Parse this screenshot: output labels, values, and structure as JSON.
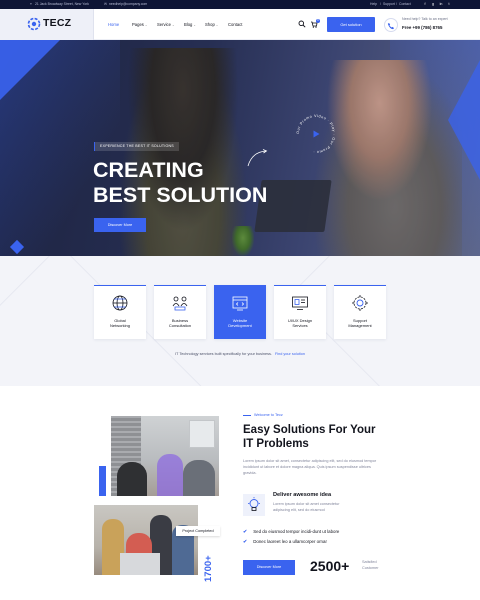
{
  "topbar": {
    "address": "21 Jack Broadway Street, New York",
    "email": "needhelp@company.com",
    "links": [
      "Help",
      "Support",
      "Contact"
    ],
    "social": [
      "facebook-icon",
      "google-plus-icon",
      "linkedin-icon",
      "twitter-icon"
    ]
  },
  "header": {
    "logo": "TECZ",
    "nav": [
      {
        "label": "Home",
        "active": true,
        "dropdown": false
      },
      {
        "label": "Pages",
        "active": false,
        "dropdown": true
      },
      {
        "label": "Service",
        "active": false,
        "dropdown": true
      },
      {
        "label": "Blog",
        "active": false,
        "dropdown": true
      },
      {
        "label": "Shop",
        "active": false,
        "dropdown": true
      },
      {
        "label": "Contact",
        "active": false,
        "dropdown": false
      }
    ],
    "cart_count": "0",
    "cta_label": "Get solution",
    "help_text": "Need help? Talk to an expert",
    "phone": "Free +99 (786) 8765"
  },
  "hero": {
    "tag": "EXPERIENCE THE BEST IT SOLUTIONS",
    "title_line1": "CREATING",
    "title_line2": "BEST SOLUTION",
    "button": "Discover More",
    "play_ring_text": "Our Promo Video · Play · Our Promo ·"
  },
  "services": {
    "cards": [
      {
        "label_line1": "Global",
        "label_line2": "Networking",
        "icon": "globe-icon",
        "active": false
      },
      {
        "label_line1": "Business",
        "label_line2": "Consultation",
        "icon": "consultation-icon",
        "active": false
      },
      {
        "label_line1": "Website",
        "label_line2": "Development",
        "icon": "website-code-icon",
        "active": true
      },
      {
        "label_line1": "UI/UX Design",
        "label_line2": "Services",
        "icon": "design-screen-icon",
        "active": false
      },
      {
        "label_line1": "Support",
        "label_line2": "Management",
        "icon": "support-gear-icon",
        "active": false
      }
    ],
    "footer_text": "IT Technology services built specifically for your business.",
    "footer_link": "Find your solution"
  },
  "about": {
    "welcome": "Welcome to Tecz",
    "title_line1": "Easy Solutions For Your",
    "title_line2": "IT Problems",
    "description": "Lorem ipsum dolor sit amet, consectetur adipiscing elit, sed do eiusmod tempor incididunt ut labore et dolore magna aliqua. Quis ipsum suspendisse ultrices gravida.",
    "feature_title": "Deliver awesome idea",
    "feature_desc": "Lorem ipsum dolor sit amet consectetur adipiscing elit, sed do eiusmod",
    "checks": [
      "Sed do eiusmod tempor incidi-dunt ut labore",
      "Donec laoreet leo a ullamcorper ornar"
    ],
    "button": "Discover More",
    "stat_number": "2500+",
    "stat_label": "Satisfied Customer",
    "project_tag": "Project Completed",
    "project_count": "1700+"
  },
  "colors": {
    "accent": "#3a63ef",
    "dark": "#12141d",
    "topbar": "#0e1535"
  }
}
